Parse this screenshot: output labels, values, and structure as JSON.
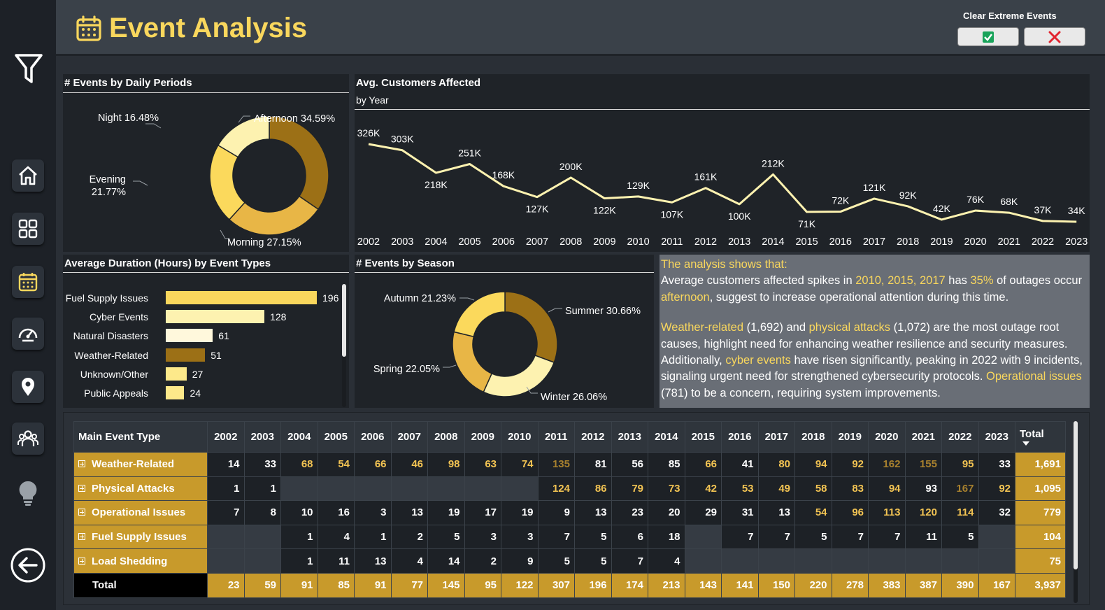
{
  "header": {
    "title": "Event Analysis",
    "clear_label": "Clear Extreme Events"
  },
  "colors": {
    "accent": "#f9d75d",
    "gold": "#c89a2b",
    "brown": "#9c7016",
    "light_yellow": "#fdf2b0",
    "panel": "#1f2328"
  },
  "sidebar": {
    "icons": [
      "filter-icon",
      "home-icon",
      "grid-icon",
      "calendar-icon",
      "gauge-icon",
      "map-pin-icon",
      "users-icon",
      "lightbulb-icon",
      "back-arrow-icon"
    ]
  },
  "daily": {
    "title": "# Events by Daily Periods",
    "labels": {
      "afternoon": "Afternoon 34.59%",
      "morning": "Morning 27.15%",
      "evening_1": "Evening",
      "evening_2": "21.77%",
      "night": "Night 16.48%"
    }
  },
  "line": {
    "title": "Avg. Customers Affected",
    "subtitle": "by Year"
  },
  "duration": {
    "title": "Average Duration (Hours) by Event Types"
  },
  "season": {
    "title": "# Events by Season",
    "labels": {
      "summer": "Summer 30.66%",
      "winter": "Winter 26.06%",
      "spring": "Spring 22.05%",
      "autumn": "Autumn 21.23%"
    }
  },
  "analysis": {
    "heading": "The analysis shows that:",
    "p1_a": "Average customers affected spikes in ",
    "p1_years": "2010, 2015, 2017",
    "p1_b": " has ",
    "p1_pct": "35%",
    "p1_c": " of outages occur ",
    "p1_afternoon": "afternoon",
    "p1_d": ", suggest to increase operational attention during this time.",
    "p2_weather": "Weather-related",
    "p2_a": " (1,692) and ",
    "p2_physical": "physical attacks",
    "p2_b": " (1,072) are the most outage root causes, highlight need for enhancing weather resilience and security measures. Additionally, ",
    "p2_cyber": "cyber events",
    "p2_c": " have risen significantly, peaking in 2022 with 9 incidents, signaling urgent need for strengthened cybersecurity protocols. ",
    "p2_operational": "Operational issues",
    "p2_d": " (781) to be a concern, requiring system improvements."
  },
  "chart_data": [
    {
      "type": "pie",
      "title": "# Events by Daily Periods",
      "categories": [
        "Afternoon",
        "Morning",
        "Evening",
        "Night"
      ],
      "values": [
        34.59,
        27.15,
        21.77,
        16.48
      ],
      "colors": [
        "#9c7016",
        "#e8b646",
        "#fbd95c",
        "#fdf2b0"
      ],
      "donut": true
    },
    {
      "type": "line",
      "title": "Avg. Customers Affected",
      "subtitle": "by Year",
      "x": [
        "2002",
        "2003",
        "2004",
        "2005",
        "2006",
        "2007",
        "2008",
        "2009",
        "2010",
        "2011",
        "2012",
        "2013",
        "2014",
        "2015",
        "2016",
        "2017",
        "2018",
        "2019",
        "2020",
        "2021",
        "2022",
        "2023"
      ],
      "values": [
        326,
        303,
        218,
        251,
        168,
        127,
        200,
        122,
        129,
        107,
        161,
        100,
        212,
        71,
        72,
        121,
        92,
        42,
        76,
        68,
        37,
        34
      ],
      "data_labels": [
        "326K",
        "303K",
        "218K",
        "251K",
        "168K",
        "127K",
        "200K",
        "122K",
        "129K",
        "107K",
        "161K",
        "100K",
        "212K",
        "71K",
        "72K",
        "121K",
        "92K",
        "42K",
        "76K",
        "68K",
        "37K",
        "34K"
      ],
      "color": "#fdf2b0"
    },
    {
      "type": "bar",
      "orientation": "horizontal",
      "title": "Average Duration (Hours) by Event Types",
      "categories": [
        "Fuel Supply Issues",
        "Cyber Events",
        "Natural Disasters",
        "Weather-Related",
        "Unknown/Other",
        "Public Appeals"
      ],
      "values": [
        196,
        128,
        61,
        51,
        27,
        24
      ],
      "colors": [
        "#f9d75d",
        "#fdf2b0",
        "#fff8dc",
        "#9c7016",
        "#fde98a",
        "#fde98a"
      ]
    },
    {
      "type": "pie",
      "title": "# Events by Season",
      "categories": [
        "Summer",
        "Winter",
        "Spring",
        "Autumn"
      ],
      "values": [
        30.66,
        26.06,
        22.05,
        21.23
      ],
      "colors": [
        "#9c7016",
        "#fdf2b0",
        "#e8b646",
        "#fbd95c"
      ],
      "donut": true
    },
    {
      "type": "table",
      "title": "Main Event Type",
      "columns": [
        "Main Event Type",
        "2002",
        "2003",
        "2004",
        "2005",
        "2006",
        "2007",
        "2008",
        "2009",
        "2010",
        "2011",
        "2012",
        "2013",
        "2014",
        "2015",
        "2016",
        "2017",
        "2018",
        "2019",
        "2020",
        "2021",
        "2022",
        "2023",
        "Total"
      ],
      "rows": [
        {
          "label": "Weather-Related",
          "values": [
            "14",
            "33",
            "68",
            "54",
            "66",
            "46",
            "98",
            "63",
            "74",
            "135",
            "81",
            "56",
            "85",
            "66",
            "41",
            "80",
            "94",
            "92",
            "162",
            "155",
            "95",
            "33"
          ],
          "total": "1,691"
        },
        {
          "label": "Physical Attacks",
          "values": [
            "1",
            "1",
            "",
            "",
            "",
            "",
            "",
            "",
            "",
            "124",
            "86",
            "79",
            "73",
            "42",
            "53",
            "49",
            "58",
            "83",
            "94",
            "93",
            "167",
            "92"
          ],
          "total": "1,095"
        },
        {
          "label": "Operational Issues",
          "values": [
            "7",
            "8",
            "10",
            "16",
            "3",
            "13",
            "19",
            "17",
            "19",
            "9",
            "13",
            "23",
            "20",
            "29",
            "31",
            "13",
            "54",
            "96",
            "113",
            "120",
            "114",
            "32"
          ],
          "total": "779"
        },
        {
          "label": "Fuel Supply Issues",
          "values": [
            "",
            "",
            "1",
            "4",
            "1",
            "2",
            "5",
            "3",
            "3",
            "7",
            "5",
            "6",
            "18",
            "",
            "7",
            "7",
            "5",
            "7",
            "7",
            "11",
            "5",
            ""
          ],
          "total": "104"
        },
        {
          "label": "Load Shedding",
          "values": [
            "",
            "",
            "1",
            "11",
            "13",
            "4",
            "14",
            "2",
            "9",
            "5",
            "5",
            "7",
            "4",
            "",
            "",
            "",
            "",
            "",
            "",
            "",
            "",
            ""
          ],
          "total": "75"
        }
      ],
      "total_row": {
        "label": "Total",
        "values": [
          "23",
          "59",
          "91",
          "85",
          "91",
          "77",
          "145",
          "95",
          "122",
          "307",
          "196",
          "174",
          "213",
          "143",
          "141",
          "150",
          "220",
          "278",
          "383",
          "387",
          "390",
          "167"
        ],
        "total": "3,937"
      }
    }
  ]
}
